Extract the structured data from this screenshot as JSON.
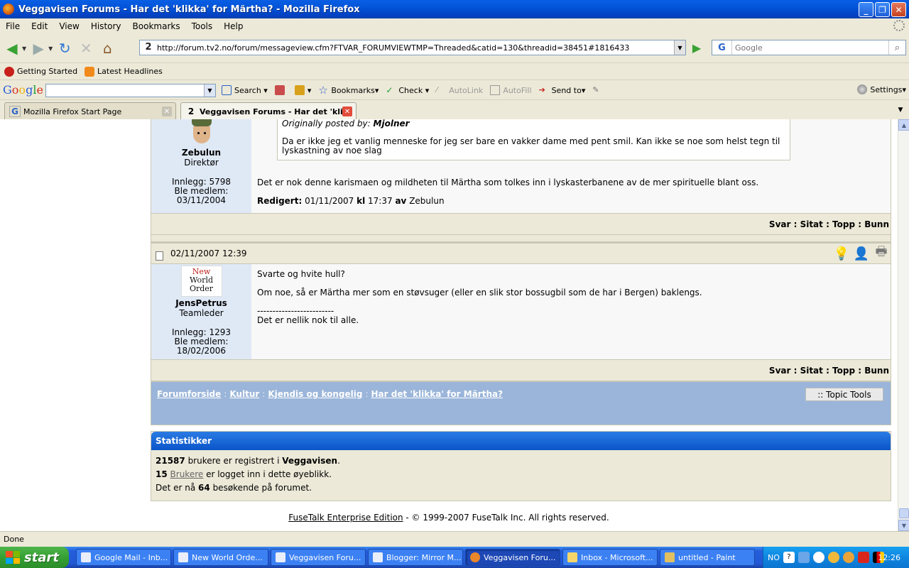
{
  "window": {
    "title": "Veggavisen Forums - Har det 'klikka' for Märtha? - Mozilla Firefox",
    "minimize": "_",
    "maximize": "❐",
    "close": "✕"
  },
  "menu": [
    "File",
    "Edit",
    "View",
    "History",
    "Bookmarks",
    "Tools",
    "Help"
  ],
  "navigation": {
    "url": "http://forum.tv2.no/forum/messageview.cfm?FTVAR_FORUMVIEWTMP=Threaded&catid=130&threadid=38451#1816433",
    "site_icon_text": "2",
    "search_engine_letter": "G",
    "search_placeholder": "Google"
  },
  "bookmarks": [
    "Getting Started",
    "Latest Headlines"
  ],
  "google_toolbar": {
    "search": "Search",
    "bookmarks": "Bookmarks",
    "check": "Check",
    "autolink": "AutoLink",
    "autofill": "AutoFill",
    "send_to": "Send to",
    "settings": "Settings"
  },
  "tabs": [
    {
      "label": "Mozilla Firefox Start Page",
      "active": false
    },
    {
      "label": "Veggavisen Forums - Har det 'kli...",
      "active": true
    }
  ],
  "post1": {
    "quote_header_prefix": "Originally posted by:",
    "quote_author": "Mjolner",
    "quote_text": "Da er ikke jeg et vanlig menneske for jeg ser bare en vakker dame med pent smil. Kan ikke se noe som helst tegn til lyskastning av noe slag",
    "username": "Zebulun",
    "role": "Direktør",
    "posts_label": "Innlegg: 5798",
    "member_label": "Ble medlem:",
    "member_date": "03/11/2004",
    "body": "Det er nok denne karismaen og mildheten til Märtha som tolkes inn i lyskasterbanene av de mer spirituelle blant oss.",
    "edited_label": "Redigert:",
    "edited_date": "01/11/2007",
    "edited_kl": "kl",
    "edited_time": "17:37",
    "edited_av": "av",
    "edited_by": "Zebulun"
  },
  "actions": {
    "reply": "Svar",
    "quote": "Sitat",
    "top": "Topp",
    "bottom": "Bunn",
    "sep": " : "
  },
  "post2": {
    "datetime": "02/11/2007 12:39",
    "avatar_lines": [
      "New",
      "World",
      "Order"
    ],
    "username": "JensPetrus",
    "role": "Teamleder",
    "posts_label": "Innlegg: 1293",
    "member_label": "Ble medlem:",
    "member_date": "18/02/2006",
    "line1": "Svarte og hvite hull?",
    "line2": "Om noe, så er Märtha mer som en støvsuger (eller en slik stor bossugbil som de har i Bergen) baklengs.",
    "sig_rule": "-------------------------",
    "signature": "Det er nellik nok til alle."
  },
  "breadcrumb": {
    "items": [
      "Forumforside",
      "Kultur",
      "Kjendis og kongelig",
      "Har det 'klikka' for Märtha?"
    ],
    "sep": ":",
    "topic_tools": ":: Topic Tools"
  },
  "stats": {
    "title": "Statistikker",
    "users_count": "21587",
    "users_text": " brukere er registrert i ",
    "site_name": "Veggavisen",
    "period": ".",
    "online_count": "15",
    "online_link": "Brukere",
    "online_text": " er logget inn i dette øyeblikk.",
    "visitors_prefix": "Det er nå ",
    "visitors_count": "64",
    "visitors_suffix": " besøkende på forumet."
  },
  "footer": {
    "link": "FuseTalk Enterprise Edition",
    "text": " - © 1999-2007 FuseTalk Inc. All rights reserved."
  },
  "status": "Done",
  "taskbar": {
    "start": "start",
    "tasks": [
      {
        "label": "Google Mail - Inb...",
        "active": false
      },
      {
        "label": "New World Orde...",
        "active": false
      },
      {
        "label": "Veggavisen Foru...",
        "active": false
      },
      {
        "label": "Blogger: Mirror M...",
        "active": false
      },
      {
        "label": "Veggavisen Foru...",
        "active": true
      },
      {
        "label": "Inbox - Microsoft...",
        "active": false
      },
      {
        "label": "untitled - Paint",
        "active": false
      }
    ],
    "lang": "NO",
    "clock": "12:26"
  }
}
